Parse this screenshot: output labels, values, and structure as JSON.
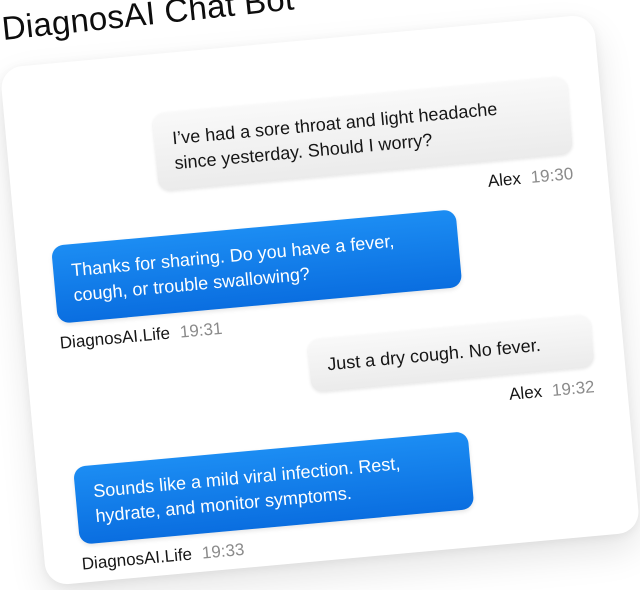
{
  "app": {
    "title": "DiagnosAI Chat Bot"
  },
  "colors": {
    "bot_bubble": "#1283ee",
    "user_bubble": "#f1f1f1",
    "timestamp": "#8b8b8b"
  },
  "messages": [
    {
      "role": "user",
      "text": "I’ve had a sore throat and light headache\nsince yesterday. Should I worry?",
      "sender": "Alex",
      "time": "19:30"
    },
    {
      "role": "bot",
      "text": "Thanks for sharing. Do you have a fever,\ncough, or trouble swallowing?",
      "sender": "DiagnosAI.Life",
      "time": "19:31"
    },
    {
      "role": "user",
      "text": "Just a dry cough. No fever.",
      "sender": "Alex",
      "time": "19:32"
    },
    {
      "role": "bot",
      "text": "Sounds like a mild viral infection. Rest,\nhydrate, and monitor symptoms.",
      "sender": "DiagnosAI.Life",
      "time": "19:33"
    }
  ]
}
